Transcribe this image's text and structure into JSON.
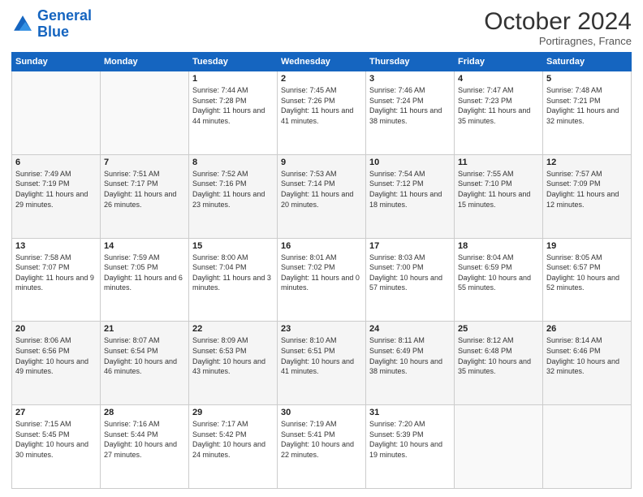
{
  "logo": {
    "line1": "General",
    "line2": "Blue"
  },
  "header": {
    "month": "October 2024",
    "location": "Portiragnes, France"
  },
  "columns": [
    "Sunday",
    "Monday",
    "Tuesday",
    "Wednesday",
    "Thursday",
    "Friday",
    "Saturday"
  ],
  "weeks": [
    [
      {
        "day": "",
        "sunrise": "",
        "sunset": "",
        "daylight": ""
      },
      {
        "day": "",
        "sunrise": "",
        "sunset": "",
        "daylight": ""
      },
      {
        "day": "1",
        "sunrise": "Sunrise: 7:44 AM",
        "sunset": "Sunset: 7:28 PM",
        "daylight": "Daylight: 11 hours and 44 minutes."
      },
      {
        "day": "2",
        "sunrise": "Sunrise: 7:45 AM",
        "sunset": "Sunset: 7:26 PM",
        "daylight": "Daylight: 11 hours and 41 minutes."
      },
      {
        "day": "3",
        "sunrise": "Sunrise: 7:46 AM",
        "sunset": "Sunset: 7:24 PM",
        "daylight": "Daylight: 11 hours and 38 minutes."
      },
      {
        "day": "4",
        "sunrise": "Sunrise: 7:47 AM",
        "sunset": "Sunset: 7:23 PM",
        "daylight": "Daylight: 11 hours and 35 minutes."
      },
      {
        "day": "5",
        "sunrise": "Sunrise: 7:48 AM",
        "sunset": "Sunset: 7:21 PM",
        "daylight": "Daylight: 11 hours and 32 minutes."
      }
    ],
    [
      {
        "day": "6",
        "sunrise": "Sunrise: 7:49 AM",
        "sunset": "Sunset: 7:19 PM",
        "daylight": "Daylight: 11 hours and 29 minutes."
      },
      {
        "day": "7",
        "sunrise": "Sunrise: 7:51 AM",
        "sunset": "Sunset: 7:17 PM",
        "daylight": "Daylight: 11 hours and 26 minutes."
      },
      {
        "day": "8",
        "sunrise": "Sunrise: 7:52 AM",
        "sunset": "Sunset: 7:16 PM",
        "daylight": "Daylight: 11 hours and 23 minutes."
      },
      {
        "day": "9",
        "sunrise": "Sunrise: 7:53 AM",
        "sunset": "Sunset: 7:14 PM",
        "daylight": "Daylight: 11 hours and 20 minutes."
      },
      {
        "day": "10",
        "sunrise": "Sunrise: 7:54 AM",
        "sunset": "Sunset: 7:12 PM",
        "daylight": "Daylight: 11 hours and 18 minutes."
      },
      {
        "day": "11",
        "sunrise": "Sunrise: 7:55 AM",
        "sunset": "Sunset: 7:10 PM",
        "daylight": "Daylight: 11 hours and 15 minutes."
      },
      {
        "day": "12",
        "sunrise": "Sunrise: 7:57 AM",
        "sunset": "Sunset: 7:09 PM",
        "daylight": "Daylight: 11 hours and 12 minutes."
      }
    ],
    [
      {
        "day": "13",
        "sunrise": "Sunrise: 7:58 AM",
        "sunset": "Sunset: 7:07 PM",
        "daylight": "Daylight: 11 hours and 9 minutes."
      },
      {
        "day": "14",
        "sunrise": "Sunrise: 7:59 AM",
        "sunset": "Sunset: 7:05 PM",
        "daylight": "Daylight: 11 hours and 6 minutes."
      },
      {
        "day": "15",
        "sunrise": "Sunrise: 8:00 AM",
        "sunset": "Sunset: 7:04 PM",
        "daylight": "Daylight: 11 hours and 3 minutes."
      },
      {
        "day": "16",
        "sunrise": "Sunrise: 8:01 AM",
        "sunset": "Sunset: 7:02 PM",
        "daylight": "Daylight: 11 hours and 0 minutes."
      },
      {
        "day": "17",
        "sunrise": "Sunrise: 8:03 AM",
        "sunset": "Sunset: 7:00 PM",
        "daylight": "Daylight: 10 hours and 57 minutes."
      },
      {
        "day": "18",
        "sunrise": "Sunrise: 8:04 AM",
        "sunset": "Sunset: 6:59 PM",
        "daylight": "Daylight: 10 hours and 55 minutes."
      },
      {
        "day": "19",
        "sunrise": "Sunrise: 8:05 AM",
        "sunset": "Sunset: 6:57 PM",
        "daylight": "Daylight: 10 hours and 52 minutes."
      }
    ],
    [
      {
        "day": "20",
        "sunrise": "Sunrise: 8:06 AM",
        "sunset": "Sunset: 6:56 PM",
        "daylight": "Daylight: 10 hours and 49 minutes."
      },
      {
        "day": "21",
        "sunrise": "Sunrise: 8:07 AM",
        "sunset": "Sunset: 6:54 PM",
        "daylight": "Daylight: 10 hours and 46 minutes."
      },
      {
        "day": "22",
        "sunrise": "Sunrise: 8:09 AM",
        "sunset": "Sunset: 6:53 PM",
        "daylight": "Daylight: 10 hours and 43 minutes."
      },
      {
        "day": "23",
        "sunrise": "Sunrise: 8:10 AM",
        "sunset": "Sunset: 6:51 PM",
        "daylight": "Daylight: 10 hours and 41 minutes."
      },
      {
        "day": "24",
        "sunrise": "Sunrise: 8:11 AM",
        "sunset": "Sunset: 6:49 PM",
        "daylight": "Daylight: 10 hours and 38 minutes."
      },
      {
        "day": "25",
        "sunrise": "Sunrise: 8:12 AM",
        "sunset": "Sunset: 6:48 PM",
        "daylight": "Daylight: 10 hours and 35 minutes."
      },
      {
        "day": "26",
        "sunrise": "Sunrise: 8:14 AM",
        "sunset": "Sunset: 6:46 PM",
        "daylight": "Daylight: 10 hours and 32 minutes."
      }
    ],
    [
      {
        "day": "27",
        "sunrise": "Sunrise: 7:15 AM",
        "sunset": "Sunset: 5:45 PM",
        "daylight": "Daylight: 10 hours and 30 minutes."
      },
      {
        "day": "28",
        "sunrise": "Sunrise: 7:16 AM",
        "sunset": "Sunset: 5:44 PM",
        "daylight": "Daylight: 10 hours and 27 minutes."
      },
      {
        "day": "29",
        "sunrise": "Sunrise: 7:17 AM",
        "sunset": "Sunset: 5:42 PM",
        "daylight": "Daylight: 10 hours and 24 minutes."
      },
      {
        "day": "30",
        "sunrise": "Sunrise: 7:19 AM",
        "sunset": "Sunset: 5:41 PM",
        "daylight": "Daylight: 10 hours and 22 minutes."
      },
      {
        "day": "31",
        "sunrise": "Sunrise: 7:20 AM",
        "sunset": "Sunset: 5:39 PM",
        "daylight": "Daylight: 10 hours and 19 minutes."
      },
      {
        "day": "",
        "sunrise": "",
        "sunset": "",
        "daylight": ""
      },
      {
        "day": "",
        "sunrise": "",
        "sunset": "",
        "daylight": ""
      }
    ]
  ]
}
